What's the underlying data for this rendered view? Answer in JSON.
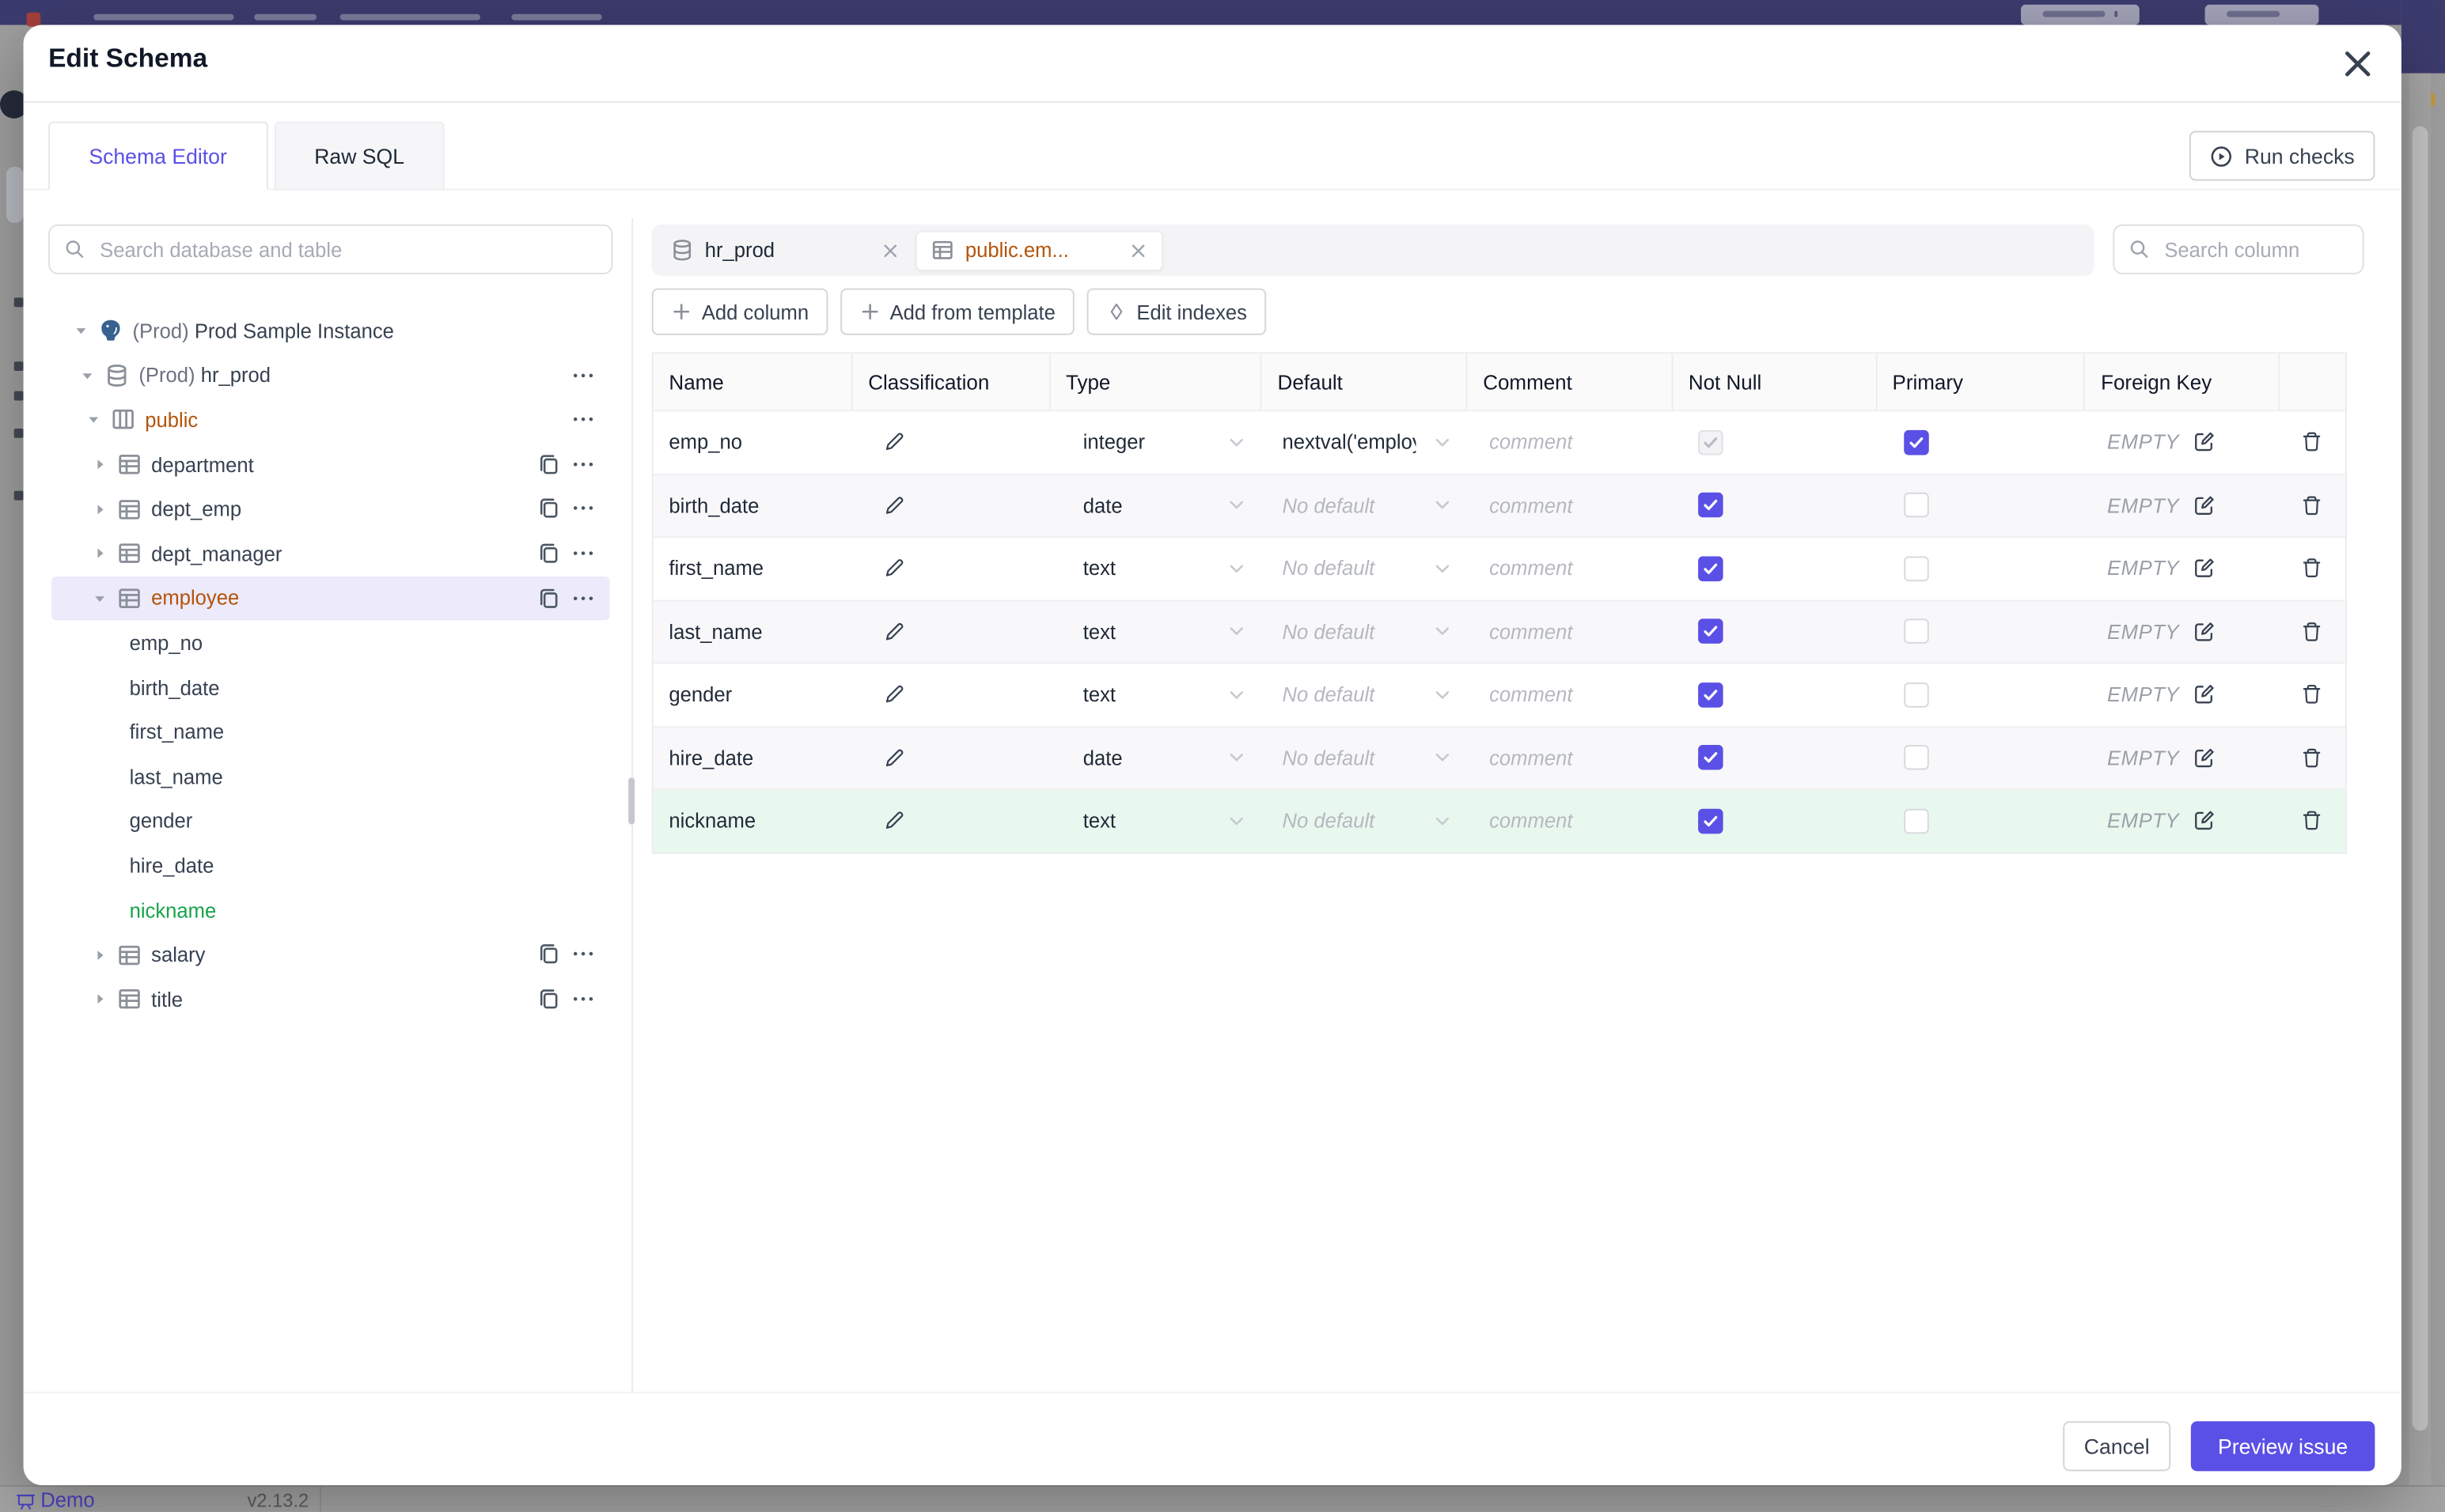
{
  "colors": {
    "accent": "#5B50E6",
    "amber": "#B45309",
    "green": "#16A34A",
    "selected_row_bg": "#ECEAFB",
    "green_row_bg": "#E9F8EF",
    "topbar": "#3C3B6E"
  },
  "background": {
    "bottom_bar": {
      "demo_label": "Demo",
      "version": "v2.13.2"
    }
  },
  "modal": {
    "title": "Edit Schema",
    "close_icon": "close-x",
    "tabs": [
      {
        "label": "Schema Editor",
        "active": true
      },
      {
        "label": "Raw SQL",
        "active": false
      }
    ],
    "run_checks": {
      "icon": "play-circle",
      "label": "Run checks"
    },
    "sidebar": {
      "search": {
        "icon": "search",
        "placeholder": "Search database and table",
        "value": ""
      },
      "tree": [
        {
          "prefix": "(Prod) ",
          "label": "Prod Sample Instance",
          "icon": "postgres",
          "level": 0,
          "caret": "down"
        },
        {
          "prefix": "(Prod) ",
          "label": "hr_prod",
          "icon": "database",
          "level": 1,
          "caret": "down",
          "menu": true
        },
        {
          "label": "public",
          "icon": "schema",
          "level": 2,
          "caret": "down",
          "menu": true,
          "tone": "amber"
        },
        {
          "label": "department",
          "icon": "table",
          "level": 3,
          "caret": "right",
          "copy": true,
          "menu": true
        },
        {
          "label": "dept_emp",
          "icon": "table",
          "level": 3,
          "caret": "right",
          "copy": true,
          "menu": true
        },
        {
          "label": "dept_manager",
          "icon": "table",
          "level": 3,
          "caret": "right",
          "copy": true,
          "menu": true
        },
        {
          "label": "employee",
          "icon": "table",
          "level": 3,
          "caret": "down",
          "copy": true,
          "menu": true,
          "tone": "amber",
          "selected": true
        },
        {
          "label": "emp_no",
          "level": "column"
        },
        {
          "label": "birth_date",
          "level": "column"
        },
        {
          "label": "first_name",
          "level": "column"
        },
        {
          "label": "last_name",
          "level": "column"
        },
        {
          "label": "gender",
          "level": "column"
        },
        {
          "label": "hire_date",
          "level": "column"
        },
        {
          "label": "nickname",
          "level": "column",
          "tone": "green"
        },
        {
          "label": "salary",
          "icon": "table",
          "level": 3,
          "caret": "right",
          "copy": true,
          "menu": true
        },
        {
          "label": "title",
          "icon": "table",
          "level": 3,
          "caret": "right",
          "copy": true,
          "menu": true
        }
      ]
    },
    "main": {
      "tab_chips": [
        {
          "label": "hr_prod",
          "icon": "database",
          "close_icon": "close-x",
          "active": false
        },
        {
          "label": "public.em...",
          "icon": "table",
          "close_icon": "close-x",
          "active": true
        }
      ],
      "column_search": {
        "icon": "search",
        "placeholder": "Search column",
        "value": ""
      },
      "toolbar": [
        {
          "icon": "plus",
          "label": "Add column"
        },
        {
          "icon": "plus",
          "label": "Add from template"
        },
        {
          "icon": "diamond",
          "label": "Edit indexes"
        }
      ],
      "table": {
        "headers": [
          "Name",
          "Classification",
          "Type",
          "Default",
          "Comment",
          "Not Null",
          "Primary",
          "Foreign Key",
          ""
        ],
        "comment_placeholder": "comment",
        "foreign_key_value": "EMPTY",
        "rows": [
          {
            "name": "emp_no",
            "type": "integer",
            "default": "nextval('employ",
            "default_is_placeholder": false,
            "not_null_checked": true,
            "not_null_disabled": true,
            "primary_checked": true,
            "tone": "default"
          },
          {
            "name": "birth_date",
            "type": "date",
            "default": "No default",
            "default_is_placeholder": true,
            "not_null_checked": true,
            "not_null_disabled": false,
            "primary_checked": false,
            "tone": "default"
          },
          {
            "name": "first_name",
            "type": "text",
            "default": "No default",
            "default_is_placeholder": true,
            "not_null_checked": true,
            "not_null_disabled": false,
            "primary_checked": false,
            "tone": "default"
          },
          {
            "name": "last_name",
            "type": "text",
            "default": "No default",
            "default_is_placeholder": true,
            "not_null_checked": true,
            "not_null_disabled": false,
            "primary_checked": false,
            "tone": "default"
          },
          {
            "name": "gender",
            "type": "text",
            "default": "No default",
            "default_is_placeholder": true,
            "not_null_checked": true,
            "not_null_disabled": false,
            "primary_checked": false,
            "tone": "default"
          },
          {
            "name": "hire_date",
            "type": "date",
            "default": "No default",
            "default_is_placeholder": true,
            "not_null_checked": true,
            "not_null_disabled": false,
            "primary_checked": false,
            "tone": "default"
          },
          {
            "name": "nickname",
            "type": "text",
            "default": "No default",
            "default_is_placeholder": true,
            "not_null_checked": true,
            "not_null_disabled": false,
            "primary_checked": false,
            "tone": "green"
          }
        ]
      }
    },
    "footer": {
      "cancel_label": "Cancel",
      "submit_label": "Preview issue"
    }
  }
}
